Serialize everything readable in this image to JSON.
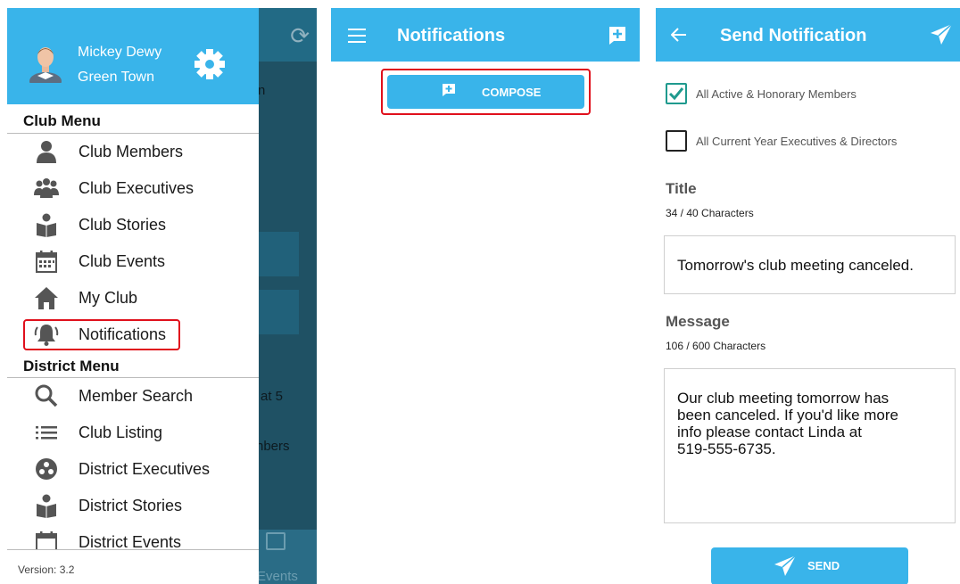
{
  "screen1": {
    "user": {
      "name": "Mickey Dewy",
      "town": "Green Town"
    },
    "club_menu_title": "Club Menu",
    "club_menu": [
      {
        "label": "Club Members",
        "icon": "person-icon"
      },
      {
        "label": "Club Executives",
        "icon": "group-icon"
      },
      {
        "label": "Club Stories",
        "icon": "reader-icon"
      },
      {
        "label": "Club Events",
        "icon": "calendar-icon"
      },
      {
        "label": "My Club",
        "icon": "home-icon"
      },
      {
        "label": "Notifications",
        "icon": "bell-icon"
      }
    ],
    "district_menu_title": "District Menu",
    "district_menu": [
      {
        "label": "Member Search",
        "icon": "search-icon"
      },
      {
        "label": "Club Listing",
        "icon": "list-icon"
      },
      {
        "label": "District Executives",
        "icon": "district-group-icon"
      },
      {
        "label": "District Stories",
        "icon": "reader-icon"
      },
      {
        "label": "District Events",
        "icon": "calendar-icon"
      }
    ],
    "version": "Version: 3.2",
    "background_fragments": {
      "f1": "n",
      "f2": "at 5",
      "f3": "nbers",
      "events": "Events"
    }
  },
  "screen2": {
    "title": "Notifications",
    "compose_label": "COMPOSE"
  },
  "screen3": {
    "title": "Send Notification",
    "recipients": [
      {
        "label": "All Active & Honorary Members",
        "checked": true
      },
      {
        "label": "All Current Year Executives & Directors",
        "checked": false
      }
    ],
    "title_label": "Title",
    "title_count": "34 / 40 Characters",
    "title_value": "Tomorrow's club meeting canceled.",
    "message_label": "Message",
    "message_count": "106 / 600 Characters",
    "message_lines": [
      "Our club meeting tomorrow has",
      "been canceled. If you'd like more",
      "info please contact Linda at",
      "519-555-6735."
    ],
    "send_label": "SEND"
  },
  "colors": {
    "accent": "#39b4ea",
    "highlight": "#e0101c",
    "check": "#1f9a8e"
  }
}
